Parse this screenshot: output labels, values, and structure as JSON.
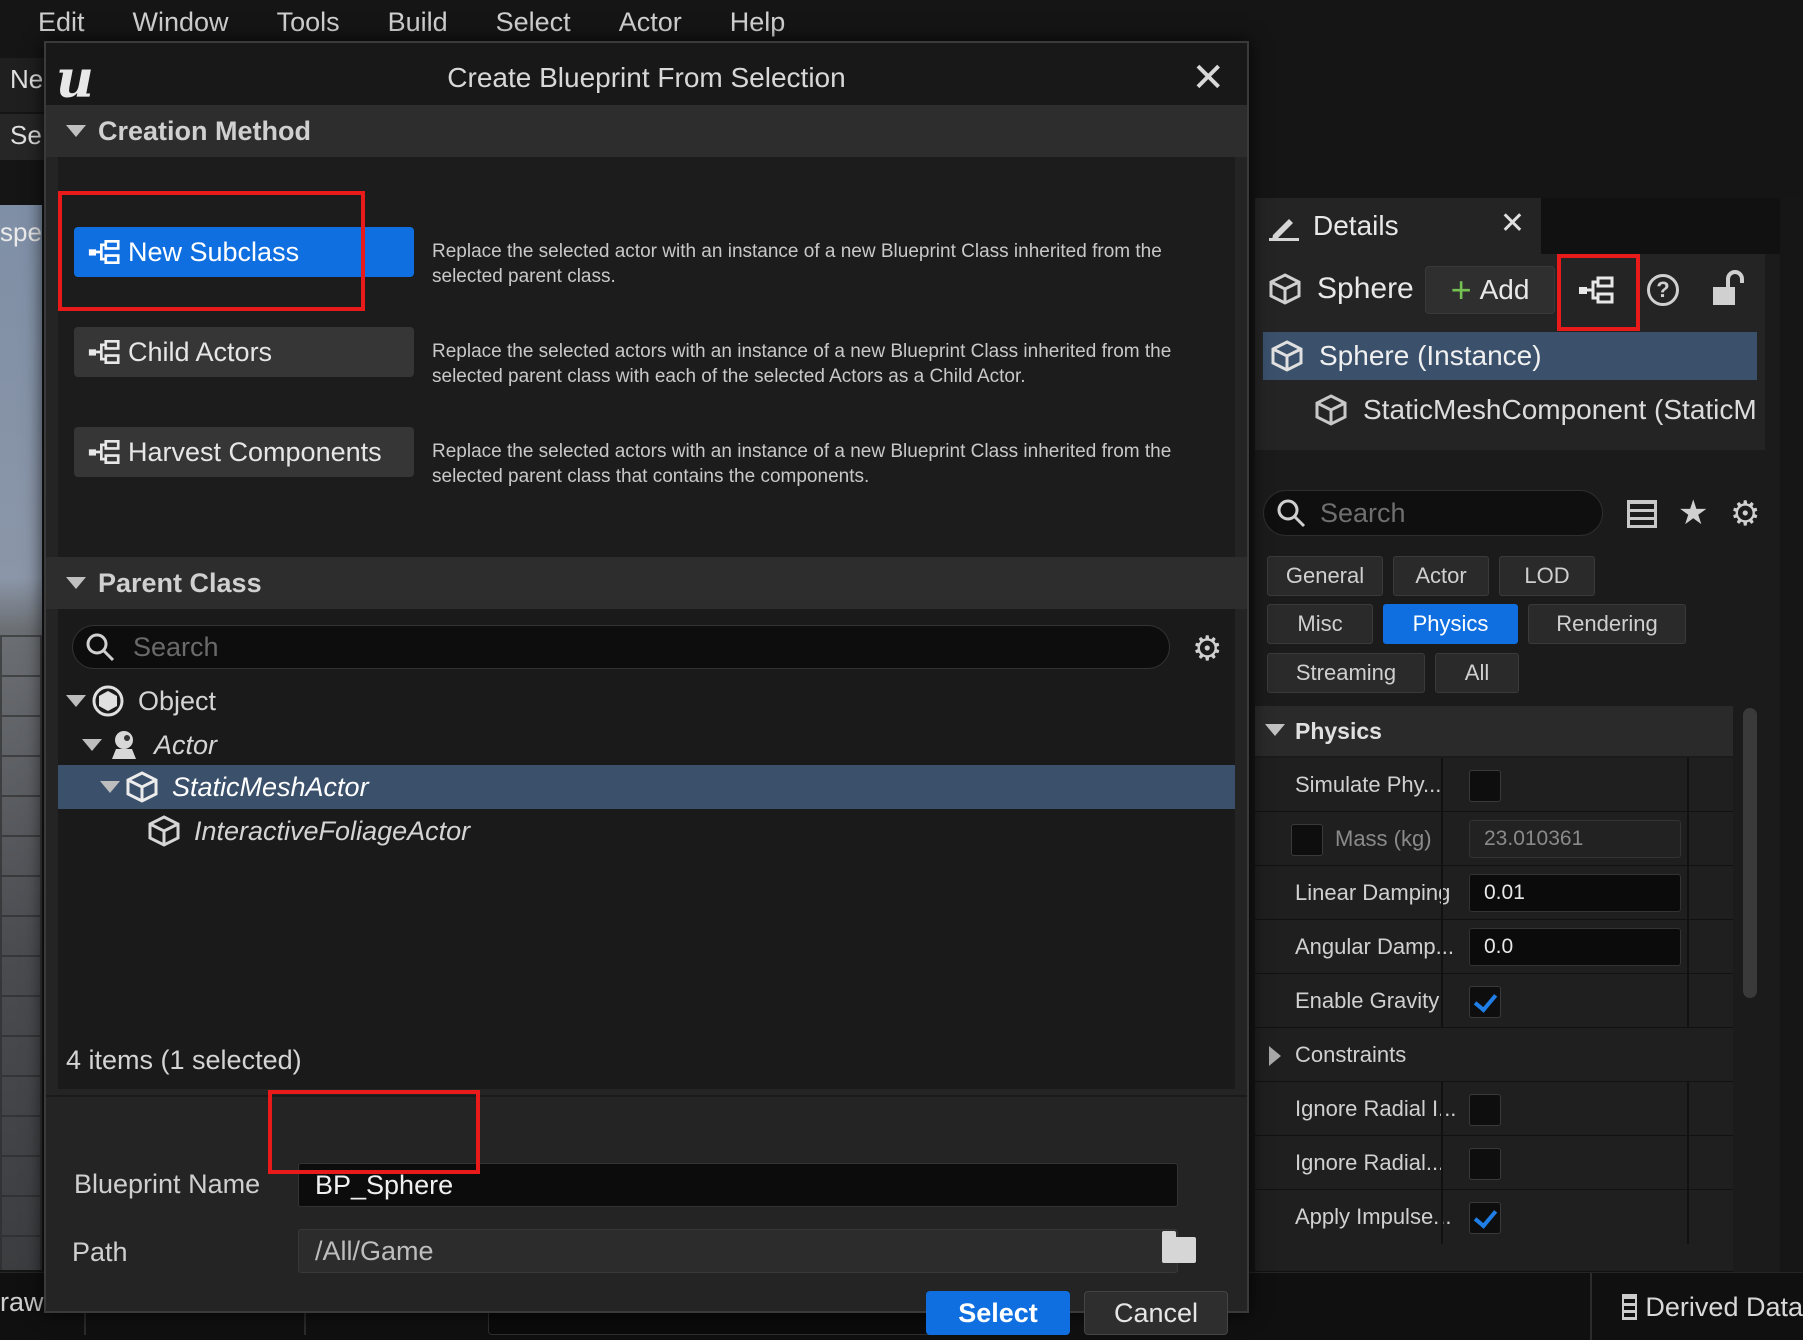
{
  "menu": [
    "Edit",
    "Window",
    "Tools",
    "Build",
    "Select",
    "Actor",
    "Help"
  ],
  "background": {
    "tab_partial_1": "Ne",
    "tab_partial_2": "Se",
    "viewport_label": "spec",
    "status_left": "rawe",
    "status_right": "Derived Data"
  },
  "dialog": {
    "title": "Create Blueprint From Selection",
    "creation_method": {
      "header": "Creation Method",
      "options": [
        {
          "label": "New Subclass",
          "desc": "Replace the selected actor with an instance of a new Blueprint Class inherited from the selected parent class."
        },
        {
          "label": "Child Actors",
          "desc": "Replace the selected actors with an instance of a new Blueprint Class inherited from the selected parent class with each of the selected Actors as a Child Actor."
        },
        {
          "label": "Harvest Components",
          "desc": "Replace the selected actors with an instance of a new Blueprint Class inherited from the selected parent class that contains the components."
        }
      ]
    },
    "parent_class": {
      "header": "Parent Class",
      "search_placeholder": "Search",
      "tree": [
        {
          "label": "Object"
        },
        {
          "label": "Actor"
        },
        {
          "label": "StaticMeshActor"
        },
        {
          "label": "InteractiveFoliageActor"
        }
      ],
      "count": "4 items (1 selected)"
    },
    "blueprint_name_label": "Blueprint Name",
    "blueprint_name_value": "BP_Sphere",
    "path_label": "Path",
    "path_value": "/All/Game",
    "select_label": "Select",
    "cancel_label": "Cancel"
  },
  "details": {
    "tab_title": "Details",
    "actor_name": "Sphere",
    "add_label": "Add",
    "components": [
      "Sphere (Instance)",
      "StaticMeshComponent (StaticM"
    ],
    "search_placeholder": "Search",
    "filters": [
      "General",
      "Actor",
      "LOD",
      "Misc",
      "Physics",
      "Rendering",
      "Streaming",
      "All"
    ],
    "active_filter": "Physics",
    "category": "Physics",
    "properties": [
      {
        "label": "Simulate Phy...",
        "type": "check",
        "value": false
      },
      {
        "label": "Mass (kg)",
        "type": "number",
        "value": "23.010361",
        "dim": true
      },
      {
        "label": "Linear Damping",
        "type": "number",
        "value": "0.01"
      },
      {
        "label": "Angular Damp...",
        "type": "number",
        "value": "0.0"
      },
      {
        "label": "Enable Gravity",
        "type": "check",
        "value": true
      },
      {
        "label": "Constraints",
        "type": "group"
      },
      {
        "label": "Ignore Radial I...",
        "type": "check",
        "value": false
      },
      {
        "label": "Ignore Radial...",
        "type": "check",
        "value": false
      },
      {
        "label": "Apply Impulse...",
        "type": "check",
        "value": true
      }
    ]
  },
  "colors": {
    "accent": "#0f6fe0",
    "selection": "#3a506b",
    "highlight": "#e81a1a"
  }
}
